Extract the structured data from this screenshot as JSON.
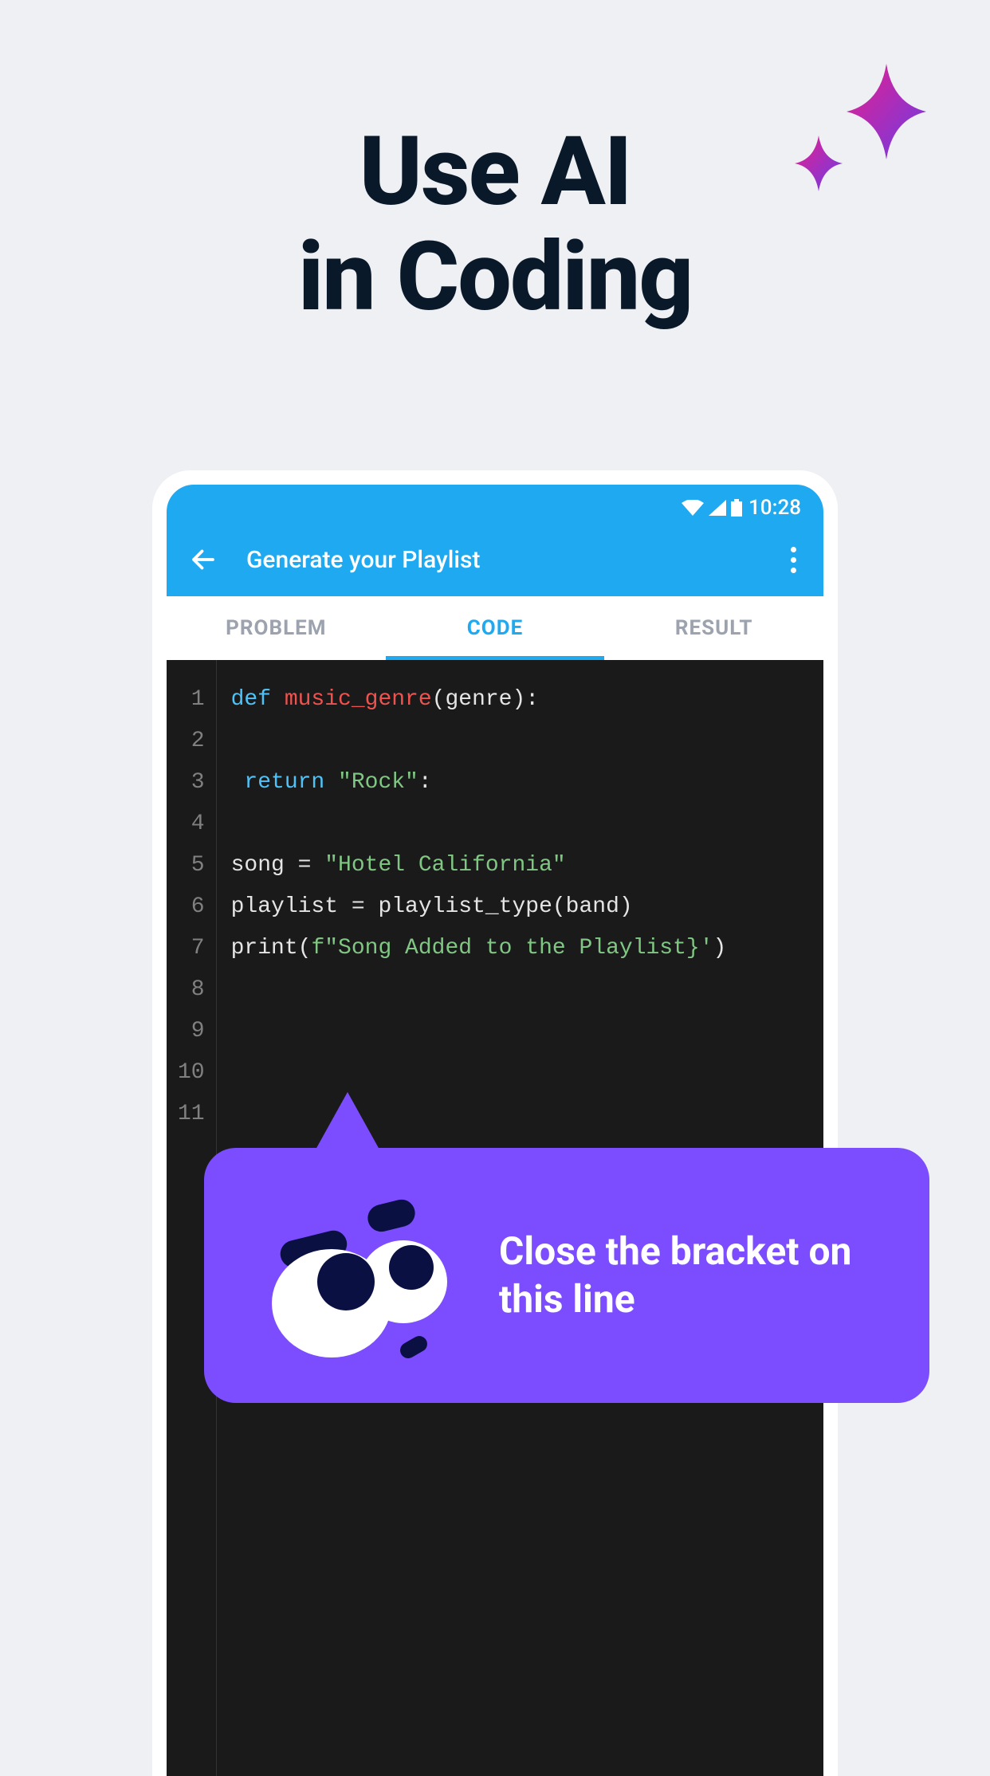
{
  "headline": {
    "line1": "Use AI",
    "line2": "in Coding"
  },
  "status_bar": {
    "time": "10:28"
  },
  "app_bar": {
    "title": "Generate your Playlist"
  },
  "tabs": [
    {
      "label": "PROBLEM",
      "active": false
    },
    {
      "label": "CODE",
      "active": true
    },
    {
      "label": "RESULT",
      "active": false
    }
  ],
  "code": {
    "line_count": 11,
    "lines": [
      {
        "n": 1,
        "tokens": [
          {
            "cls": "kw-def",
            "t": "def "
          },
          {
            "cls": "fn-name",
            "t": "music_genre"
          },
          {
            "cls": "text",
            "t": "(genre):"
          }
        ]
      },
      {
        "n": 2,
        "tokens": []
      },
      {
        "n": 3,
        "tokens": [
          {
            "cls": "text",
            "t": " "
          },
          {
            "cls": "kw-return",
            "t": "return "
          },
          {
            "cls": "string",
            "t": "\"Rock\""
          },
          {
            "cls": "text",
            "t": ":"
          }
        ]
      },
      {
        "n": 4,
        "tokens": []
      },
      {
        "n": 5,
        "tokens": [
          {
            "cls": "text",
            "t": "song = "
          },
          {
            "cls": "string",
            "t": "\"Hotel California\""
          }
        ]
      },
      {
        "n": 6,
        "tokens": [
          {
            "cls": "text",
            "t": "playlist = playlist_type(band)"
          }
        ]
      },
      {
        "n": 7,
        "tokens": [
          {
            "cls": "text",
            "t": "print("
          },
          {
            "cls": "fstring",
            "t": "f\"Song Added to the Playlist}'"
          },
          {
            "cls": "text",
            "t": ")"
          }
        ]
      },
      {
        "n": 8,
        "tokens": []
      },
      {
        "n": 9,
        "tokens": []
      },
      {
        "n": 10,
        "tokens": []
      },
      {
        "n": 11,
        "tokens": []
      }
    ]
  },
  "ai_tooltip": {
    "text": "Close the bracket on this line"
  }
}
